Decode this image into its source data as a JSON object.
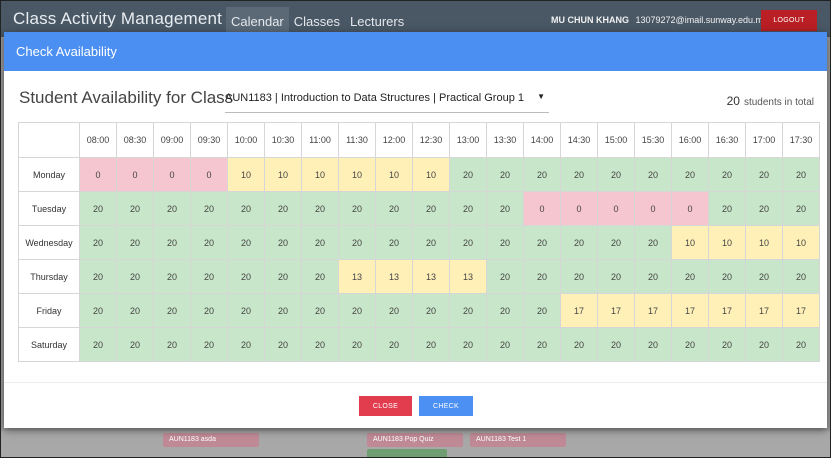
{
  "navbar": {
    "brand": "Class Activity Management System",
    "nav_items": [
      "Calendar",
      "Classes",
      "Lecturers"
    ],
    "user_name": "MU CHUN KHANG",
    "user_email": "13079272@imail.sunway.edu.my",
    "logout_label": "LOGOUT"
  },
  "background_events": [
    "AUN1183 asda",
    "AUN1183 Pop Quiz",
    "AUN1183 Test 1"
  ],
  "modal": {
    "header": "Check Availability",
    "title": "Student Availability for Class",
    "class_select": "AUN1183 | Introduction to Data Structures | Practical Group 1",
    "total_count": "20",
    "total_label": "students in total",
    "times": [
      "08:00",
      "08:30",
      "09:00",
      "09:30",
      "10:00",
      "10:30",
      "11:00",
      "11:30",
      "12:00",
      "12:30",
      "13:00",
      "13:30",
      "14:00",
      "14:30",
      "15:00",
      "15:30",
      "16:00",
      "16:30",
      "17:00",
      "17:30"
    ],
    "rows": [
      {
        "day": "Monday",
        "values": [
          0,
          0,
          0,
          0,
          10,
          10,
          10,
          10,
          10,
          10,
          20,
          20,
          20,
          20,
          20,
          20,
          20,
          20,
          20,
          20
        ]
      },
      {
        "day": "Tuesday",
        "values": [
          20,
          20,
          20,
          20,
          20,
          20,
          20,
          20,
          20,
          20,
          20,
          20,
          0,
          0,
          0,
          0,
          0,
          20,
          20,
          20
        ]
      },
      {
        "day": "Wednesday",
        "values": [
          20,
          20,
          20,
          20,
          20,
          20,
          20,
          20,
          20,
          20,
          20,
          20,
          20,
          20,
          20,
          20,
          10,
          10,
          10,
          10
        ]
      },
      {
        "day": "Thursday",
        "values": [
          20,
          20,
          20,
          20,
          20,
          20,
          20,
          13,
          13,
          13,
          13,
          20,
          20,
          20,
          20,
          20,
          20,
          20,
          20,
          20
        ]
      },
      {
        "day": "Friday",
        "values": [
          20,
          20,
          20,
          20,
          20,
          20,
          20,
          20,
          20,
          20,
          20,
          20,
          20,
          17,
          17,
          17,
          17,
          17,
          17,
          17
        ]
      },
      {
        "day": "Saturday",
        "values": [
          20,
          20,
          20,
          20,
          20,
          20,
          20,
          20,
          20,
          20,
          20,
          20,
          20,
          20,
          20,
          20,
          20,
          20,
          20,
          20
        ]
      }
    ],
    "close_label": "CLOSE",
    "check_label": "CHECK"
  },
  "colors": {
    "navbar": "#4a5866",
    "modal_header": "#4c8ff3",
    "available_all": "#c8e6c9",
    "available_partial": "#fff0b8",
    "available_none": "#f5c6cf",
    "close_button": "#e23d4f",
    "check_button": "#4b90f2",
    "logout_button": "#b91f24"
  }
}
